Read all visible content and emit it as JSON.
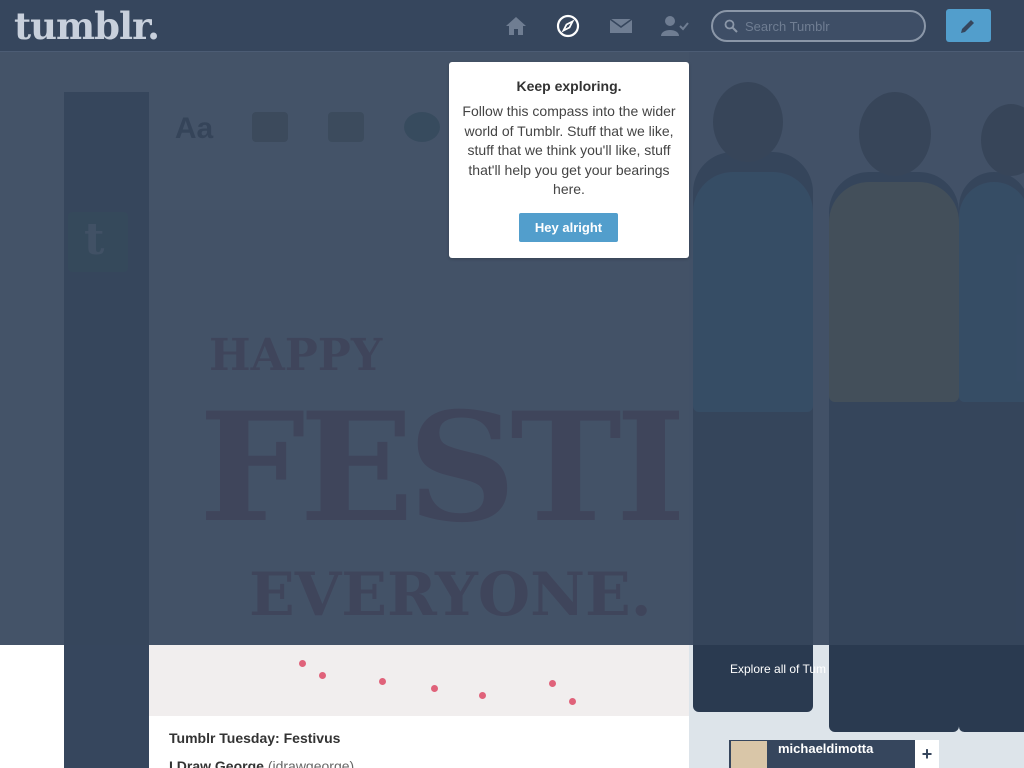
{
  "header": {
    "logo": "tumblr.",
    "search_placeholder": "Search Tumblr",
    "icons": [
      "home-icon",
      "compass-icon",
      "mail-icon",
      "account-icon",
      "pencil-icon"
    ]
  },
  "popover": {
    "title": "Keep exploring.",
    "body": "Follow this compass into the wider world of Tumblr. Stuff that we like, stuff that we think you'll like, stuff that'll help you get your bearings here.",
    "button": "Hey alright"
  },
  "post": {
    "title": "Tumblr Tuesday: Festivus",
    "author_name": "I Draw George",
    "author_handle": "(idrawgeorge)"
  },
  "radar": {
    "explore_link": "Explore all of Tum",
    "username": "michaeldimotta"
  },
  "colors": {
    "header_bg": "#36465d",
    "accent": "#529ecc",
    "overlay": "#36465d"
  }
}
